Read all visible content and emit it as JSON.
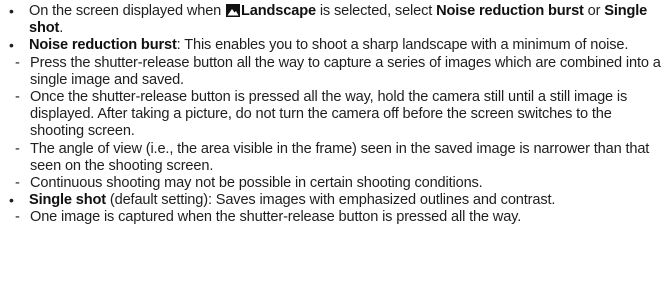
{
  "items": [
    {
      "pre": "On the screen displayed when ",
      "icon": "landscape-icon",
      "label": "Landscape",
      "mid1": " is selected, select ",
      "opt1": "Noise reduction burst",
      "mid2": " or ",
      "opt2": "Single shot",
      "post": "."
    },
    {
      "term": "Noise reduction burst",
      "desc": ": This enables you to shoot a sharp landscape with a minimum of noise.",
      "subs": [
        "Press the shutter-release button all the way to capture a series of images which are combined into a single image and saved.",
        "Once the shutter-release button is pressed all the way, hold the camera still until a still image is displayed. After taking a picture, do not turn the camera off before the screen switches to the shooting screen.",
        "The angle of view (i.e., the area visible in the frame) seen in the saved image is narrower than that seen on the shooting screen.",
        "Continuous shooting may not be possible in certain shooting conditions."
      ]
    },
    {
      "term": "Single shot",
      "desc": " (default setting): Saves images with emphasized outlines and contrast.",
      "subs": [
        "One image is captured when the shutter-release button is pressed all the way."
      ]
    }
  ],
  "bullet_char": "•",
  "dash_char": "-"
}
